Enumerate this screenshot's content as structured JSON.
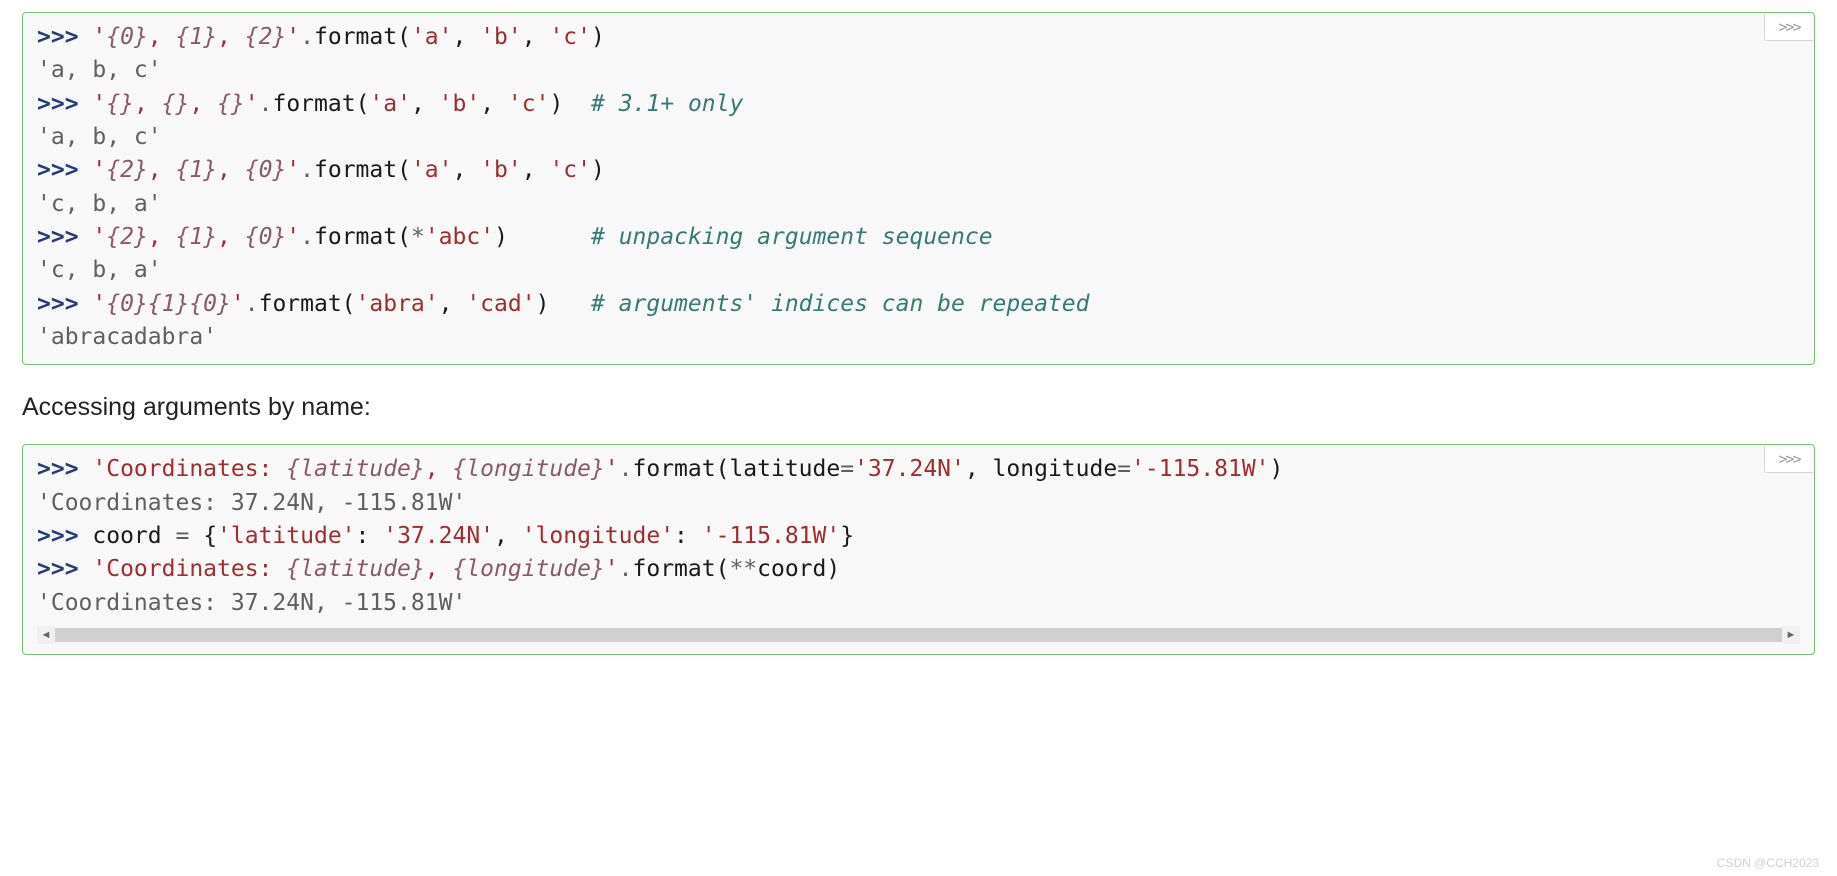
{
  "block1": {
    "badge": ">>>",
    "lines": [
      {
        "t": "in",
        "parts": [
          {
            "c": "prompt",
            "v": ">>> "
          },
          {
            "c": "str",
            "v": "'"
          },
          {
            "c": "fmt",
            "v": "{0}"
          },
          {
            "c": "str",
            "v": ", "
          },
          {
            "c": "fmt",
            "v": "{1}"
          },
          {
            "c": "str",
            "v": ", "
          },
          {
            "c": "fmt",
            "v": "{2}"
          },
          {
            "c": "str",
            "v": "'"
          },
          {
            "c": "op",
            "v": "."
          },
          {
            "c": "name",
            "v": "format("
          },
          {
            "c": "str",
            "v": "'a'"
          },
          {
            "c": "name",
            "v": ", "
          },
          {
            "c": "str",
            "v": "'b'"
          },
          {
            "c": "name",
            "v": ", "
          },
          {
            "c": "str",
            "v": "'c'"
          },
          {
            "c": "name",
            "v": ")"
          }
        ]
      },
      {
        "t": "out",
        "parts": [
          {
            "c": "output",
            "v": "'a, b, c'"
          }
        ]
      },
      {
        "t": "in",
        "parts": [
          {
            "c": "prompt",
            "v": ">>> "
          },
          {
            "c": "str",
            "v": "'"
          },
          {
            "c": "fmt",
            "v": "{}"
          },
          {
            "c": "str",
            "v": ", "
          },
          {
            "c": "fmt",
            "v": "{}"
          },
          {
            "c": "str",
            "v": ", "
          },
          {
            "c": "fmt",
            "v": "{}"
          },
          {
            "c": "str",
            "v": "'"
          },
          {
            "c": "op",
            "v": "."
          },
          {
            "c": "name",
            "v": "format("
          },
          {
            "c": "str",
            "v": "'a'"
          },
          {
            "c": "name",
            "v": ", "
          },
          {
            "c": "str",
            "v": "'b'"
          },
          {
            "c": "name",
            "v": ", "
          },
          {
            "c": "str",
            "v": "'c'"
          },
          {
            "c": "name",
            "v": ")  "
          },
          {
            "c": "comment",
            "v": "# 3.1+ only"
          }
        ]
      },
      {
        "t": "out",
        "parts": [
          {
            "c": "output",
            "v": "'a, b, c'"
          }
        ]
      },
      {
        "t": "in",
        "parts": [
          {
            "c": "prompt",
            "v": ">>> "
          },
          {
            "c": "str",
            "v": "'"
          },
          {
            "c": "fmt",
            "v": "{2}"
          },
          {
            "c": "str",
            "v": ", "
          },
          {
            "c": "fmt",
            "v": "{1}"
          },
          {
            "c": "str",
            "v": ", "
          },
          {
            "c": "fmt",
            "v": "{0}"
          },
          {
            "c": "str",
            "v": "'"
          },
          {
            "c": "op",
            "v": "."
          },
          {
            "c": "name",
            "v": "format("
          },
          {
            "c": "str",
            "v": "'a'"
          },
          {
            "c": "name",
            "v": ", "
          },
          {
            "c": "str",
            "v": "'b'"
          },
          {
            "c": "name",
            "v": ", "
          },
          {
            "c": "str",
            "v": "'c'"
          },
          {
            "c": "name",
            "v": ")"
          }
        ]
      },
      {
        "t": "out",
        "parts": [
          {
            "c": "output",
            "v": "'c, b, a'"
          }
        ]
      },
      {
        "t": "in",
        "parts": [
          {
            "c": "prompt",
            "v": ">>> "
          },
          {
            "c": "str",
            "v": "'"
          },
          {
            "c": "fmt",
            "v": "{2}"
          },
          {
            "c": "str",
            "v": ", "
          },
          {
            "c": "fmt",
            "v": "{1}"
          },
          {
            "c": "str",
            "v": ", "
          },
          {
            "c": "fmt",
            "v": "{0}"
          },
          {
            "c": "str",
            "v": "'"
          },
          {
            "c": "op",
            "v": "."
          },
          {
            "c": "name",
            "v": "format("
          },
          {
            "c": "op",
            "v": "*"
          },
          {
            "c": "str",
            "v": "'abc'"
          },
          {
            "c": "name",
            "v": ")      "
          },
          {
            "c": "comment",
            "v": "# unpacking argument sequence"
          }
        ]
      },
      {
        "t": "out",
        "parts": [
          {
            "c": "output",
            "v": "'c, b, a'"
          }
        ]
      },
      {
        "t": "in",
        "parts": [
          {
            "c": "prompt",
            "v": ">>> "
          },
          {
            "c": "str",
            "v": "'"
          },
          {
            "c": "fmt",
            "v": "{0}{1}{0}"
          },
          {
            "c": "str",
            "v": "'"
          },
          {
            "c": "op",
            "v": "."
          },
          {
            "c": "name",
            "v": "format("
          },
          {
            "c": "str",
            "v": "'abra'"
          },
          {
            "c": "name",
            "v": ", "
          },
          {
            "c": "str",
            "v": "'cad'"
          },
          {
            "c": "name",
            "v": ")   "
          },
          {
            "c": "comment",
            "v": "# arguments' indices can be repeated"
          }
        ]
      },
      {
        "t": "out",
        "parts": [
          {
            "c": "output",
            "v": "'abracadabra'"
          }
        ]
      }
    ]
  },
  "section_subtitle": "Accessing arguments by name:",
  "block2": {
    "badge": ">>>",
    "lines": [
      {
        "t": "in",
        "parts": [
          {
            "c": "prompt",
            "v": ">>> "
          },
          {
            "c": "str",
            "v": "'Coordinates: "
          },
          {
            "c": "fmt",
            "v": "{latitude}"
          },
          {
            "c": "str",
            "v": ", "
          },
          {
            "c": "fmt",
            "v": "{longitude}"
          },
          {
            "c": "str",
            "v": "'"
          },
          {
            "c": "op",
            "v": "."
          },
          {
            "c": "name",
            "v": "format(latitude"
          },
          {
            "c": "op",
            "v": "="
          },
          {
            "c": "str",
            "v": "'37.24N'"
          },
          {
            "c": "name",
            "v": ", longitude"
          },
          {
            "c": "op",
            "v": "="
          },
          {
            "c": "str",
            "v": "'-115.81W'"
          },
          {
            "c": "name",
            "v": ")"
          }
        ]
      },
      {
        "t": "out",
        "parts": [
          {
            "c": "output",
            "v": "'Coordinates: 37.24N, -115.81W'"
          }
        ]
      },
      {
        "t": "in",
        "parts": [
          {
            "c": "prompt",
            "v": ">>> "
          },
          {
            "c": "name",
            "v": "coord "
          },
          {
            "c": "op",
            "v": "= "
          },
          {
            "c": "name",
            "v": "{"
          },
          {
            "c": "str",
            "v": "'latitude'"
          },
          {
            "c": "name",
            "v": ": "
          },
          {
            "c": "str",
            "v": "'37.24N'"
          },
          {
            "c": "name",
            "v": ", "
          },
          {
            "c": "str",
            "v": "'longitude'"
          },
          {
            "c": "name",
            "v": ": "
          },
          {
            "c": "str",
            "v": "'-115.81W'"
          },
          {
            "c": "name",
            "v": "}"
          }
        ]
      },
      {
        "t": "in",
        "parts": [
          {
            "c": "prompt",
            "v": ">>> "
          },
          {
            "c": "str",
            "v": "'Coordinates: "
          },
          {
            "c": "fmt",
            "v": "{latitude}"
          },
          {
            "c": "str",
            "v": ", "
          },
          {
            "c": "fmt",
            "v": "{longitude}"
          },
          {
            "c": "str",
            "v": "'"
          },
          {
            "c": "op",
            "v": "."
          },
          {
            "c": "name",
            "v": "format("
          },
          {
            "c": "op",
            "v": "**"
          },
          {
            "c": "name",
            "v": "coord)"
          }
        ]
      },
      {
        "t": "out",
        "parts": [
          {
            "c": "output",
            "v": "'Coordinates: 37.24N, -115.81W'"
          }
        ]
      }
    ]
  },
  "watermark": "CSDN @CCH2023"
}
